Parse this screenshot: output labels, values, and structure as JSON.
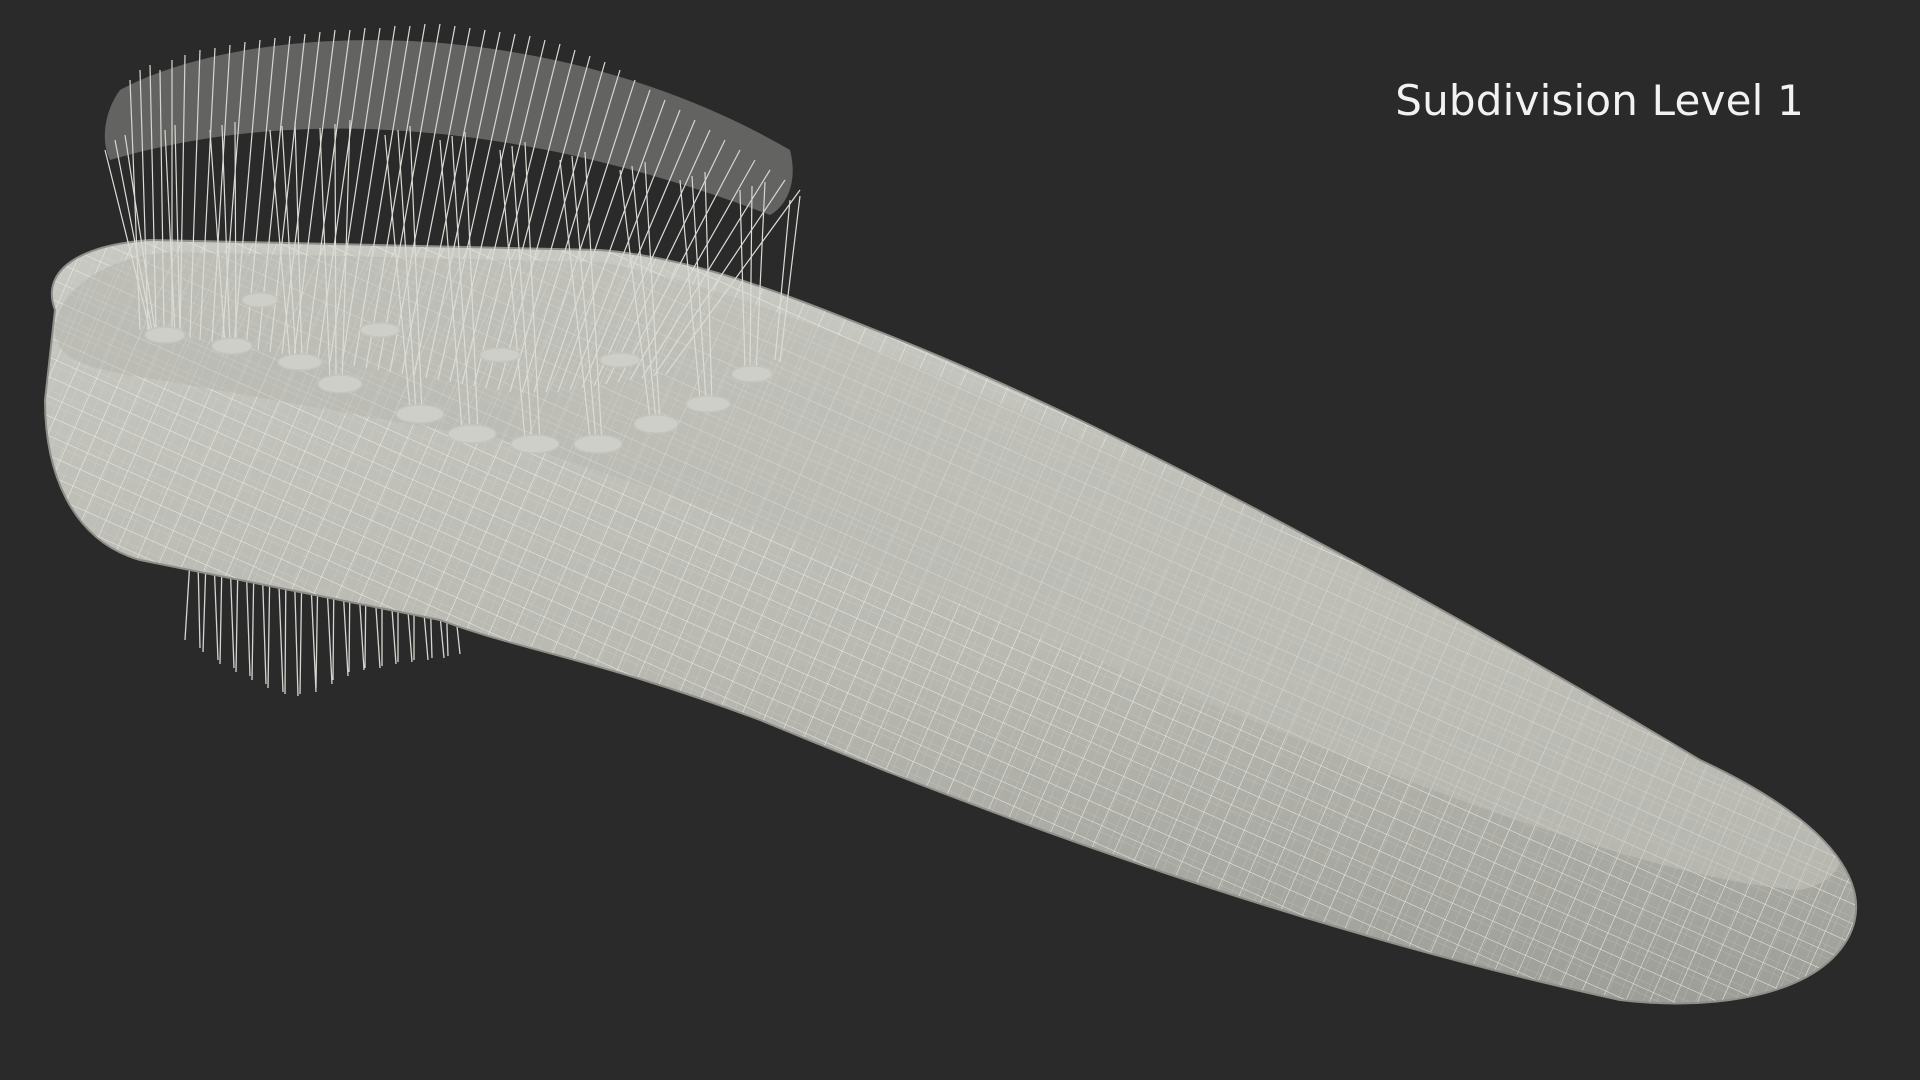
{
  "overlay": {
    "label": "Subdivision Level 1"
  },
  "scene": {
    "subject": "brush-wireframe-icon",
    "background_color": "#2a2a2a",
    "mesh_fill_color": "#bdbdb6",
    "wire_color": "#f4f4f0",
    "bristle_color": "#d8d8d2"
  }
}
